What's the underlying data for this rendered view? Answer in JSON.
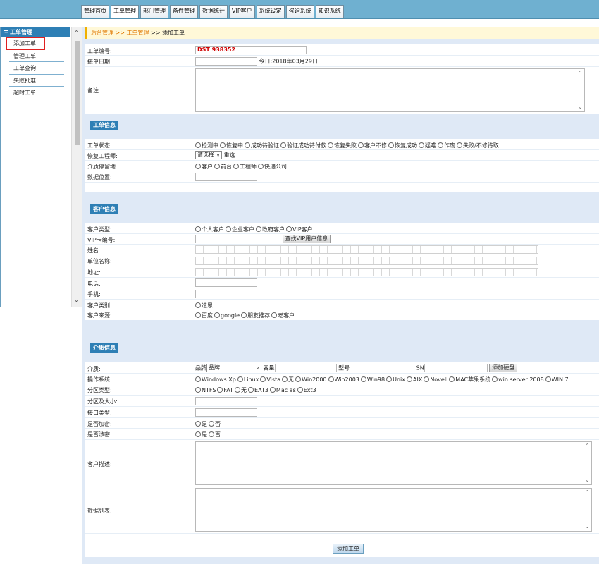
{
  "nav": {
    "tabs": [
      "管理首页",
      "工单管理",
      "部门管理",
      "备件管理",
      "数据统计",
      "VIP客户",
      "系统设定",
      "咨询系统",
      "知识系统"
    ]
  },
  "sidebar": {
    "header": "工单管理",
    "items": [
      "添加工单",
      "管理工单",
      "工单查询",
      "失败批准",
      "超时工单"
    ]
  },
  "breadcrumb": {
    "home": "后台管理",
    "sep1": " >> ",
    "section": "工单管理",
    "sep2": " >> ",
    "current": "添加工单"
  },
  "basic": {
    "order_no_label": "工单编号:",
    "order_no_value": "DST 938352",
    "date_label": "接单日期:",
    "date_today": "今日:2018年03月29日",
    "remark_label": "备注:"
  },
  "order_info": {
    "section_title": "工单信息",
    "status_label": "工单状态:",
    "status_options": [
      "检测中",
      "恢复中",
      "成功待验证",
      "验证成功待付款",
      "恢复失败",
      "客户不修",
      "恢复成功",
      "疑难",
      "作废",
      "失败/不修待取"
    ],
    "engineer_label": "恢复工程师:",
    "engineer_select": "请选择",
    "engineer_note": "重选",
    "media_loc_label": "介质停留地:",
    "media_loc_options": [
      "客户",
      "前台",
      "工程师",
      "快递公司"
    ],
    "data_pos_label": "数据位置:"
  },
  "customer_info": {
    "section_title": "客户信息",
    "type_label": "客户类型:",
    "type_options": [
      "个人客户",
      "企业客户",
      "政府客户",
      "VIP客户"
    ],
    "vip_label": "VIP卡编号:",
    "vip_button": "查找VIP用户信息",
    "name_label": "姓名:",
    "company_label": "单位名称:",
    "address_label": "地址:",
    "phone_label": "电话:",
    "mobile_label": "手机:",
    "category_label": "客户类别:",
    "category_options": [
      "迭思"
    ],
    "source_label": "客户来源:",
    "source_options": [
      "百度",
      "google",
      "朋友推荐",
      "老客户"
    ]
  },
  "media_info": {
    "section_title": "介质信息",
    "media_label": "介质:",
    "brand_label": "品牌",
    "brand_select": "品牌",
    "capacity_label": "容量",
    "model_label": "型号",
    "sn_label": "SN",
    "add_disk_button": "添加硬盘",
    "os_label": "操作系统:",
    "os_options": [
      "Windows Xp",
      "Linux",
      "Vista",
      "无",
      "Win2000",
      "Win2003",
      "Win98",
      "Unix",
      "AIX",
      "Novell",
      "MAC苹果系统",
      "win server 2008",
      "WIN 7"
    ],
    "partition_type_label": "分区类型:",
    "partition_type_options": [
      "NTFS",
      "FAT",
      "无",
      "EAT3",
      "Mac as",
      "Ext3"
    ],
    "partition_size_label": "分区及大小:",
    "interface_label": "接口类型:",
    "encrypted_label": "是否加密:",
    "encrypted_options": [
      "是",
      "否"
    ],
    "secret_label": "是否涉密:",
    "secret_options": [
      "是",
      "否"
    ],
    "desc_label": "客户描述:",
    "data_list_label": "数据列表:"
  },
  "submit_label": "添加工单"
}
